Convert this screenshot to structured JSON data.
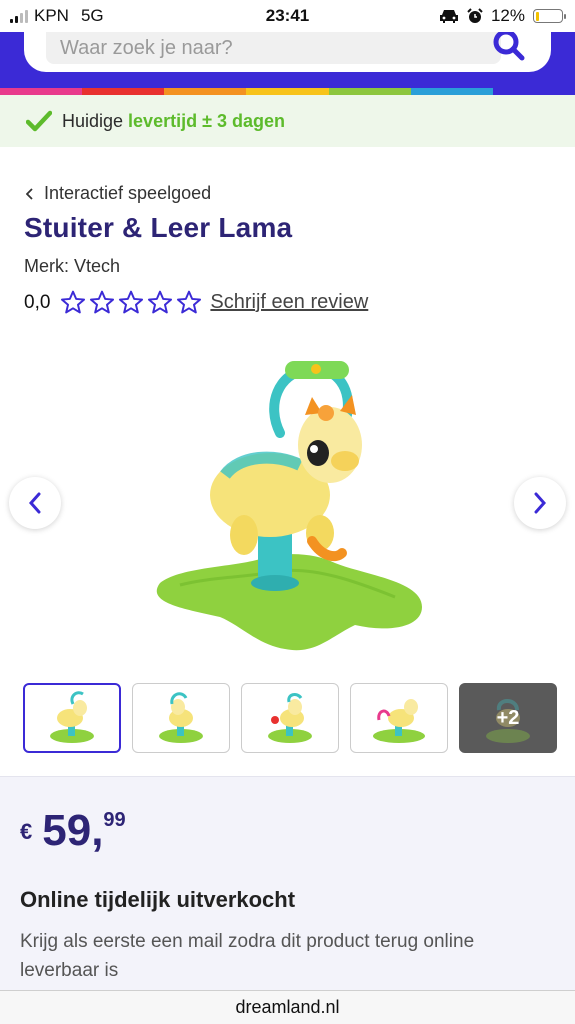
{
  "status_bar": {
    "carrier": "KPN",
    "network": "5G",
    "time": "23:41",
    "battery_percent": "12%",
    "battery_level": 0.12
  },
  "search": {
    "placeholder": "Waar zoek je naar?"
  },
  "rainbow_colors": [
    "#e83a8c",
    "#e8312f",
    "#f39221",
    "#f7c31a",
    "#8cc63e",
    "#2a9fd8",
    "#3b2ad6"
  ],
  "delivery": {
    "prefix": "Huidige",
    "highlight": "levertijd ± 3 dagen"
  },
  "product": {
    "breadcrumb": "Interactief speelgoed",
    "title": "Stuiter & Leer Lama",
    "brand": "Merk: Vtech",
    "rating_value": "0,0",
    "stars_filled": 0,
    "stars_total": 5,
    "review_link": "Schrijf een review"
  },
  "gallery": {
    "more_label": "+2"
  },
  "price": {
    "currency": "€",
    "integer": "59,",
    "decimals": "99"
  },
  "stock": {
    "title": "Online tijdelijk uitverkocht",
    "text": "Krijg als eerste een mail zodra dit product terug online leverbaar is"
  },
  "browser": {
    "domain": "dreamland.nl"
  },
  "colors": {
    "brand_purple": "#3b2ad6",
    "title_navy": "#2d2475",
    "delivery_green": "#5dbb2c"
  }
}
